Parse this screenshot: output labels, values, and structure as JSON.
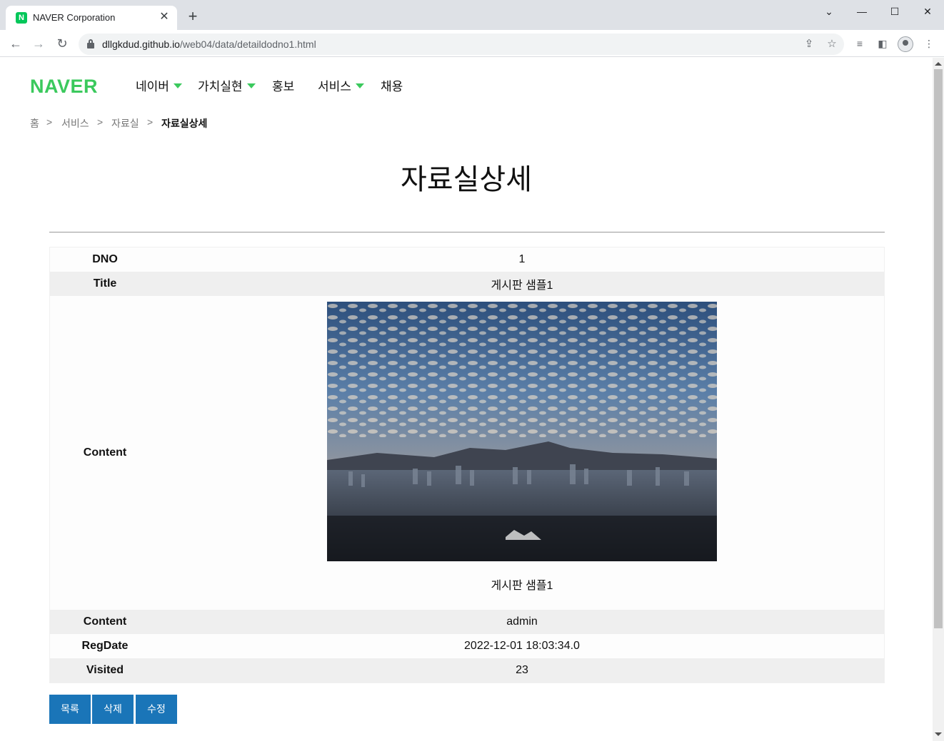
{
  "browser": {
    "tab_title": "NAVER Corporation",
    "tab_favicon_letter": "N",
    "url_host": "dllgkdud.github.io",
    "url_path": "/web04/data/detaildodno1.html"
  },
  "header": {
    "logo": "NAVER",
    "nav": [
      {
        "label": "네이버",
        "has_dropdown": true
      },
      {
        "label": "가치실현",
        "has_dropdown": true
      },
      {
        "label": "홍보",
        "has_dropdown": false
      },
      {
        "label": "서비스",
        "has_dropdown": true
      },
      {
        "label": "채용",
        "has_dropdown": false
      }
    ],
    "accent_color": "#3bc95d"
  },
  "breadcrumb": {
    "items": [
      "홈",
      "서비스",
      "자료실",
      "자료실상세"
    ],
    "separator": ">"
  },
  "page_title": "자료실상세",
  "detail": {
    "rows": [
      {
        "label": "DNO",
        "value": "1"
      },
      {
        "label": "Title",
        "value": "게시판 샘플1"
      },
      {
        "label": "Content",
        "image": "city-skyline-photo",
        "caption": "게시판 샘플1"
      },
      {
        "label": "Content",
        "value": "admin"
      },
      {
        "label": "RegDate",
        "value": "2022-12-01 18:03:34.0"
      },
      {
        "label": "Visited",
        "value": "23"
      }
    ]
  },
  "actions": {
    "list": "목록",
    "delete": "삭제",
    "edit": "수정",
    "button_color": "#1a75b8"
  }
}
